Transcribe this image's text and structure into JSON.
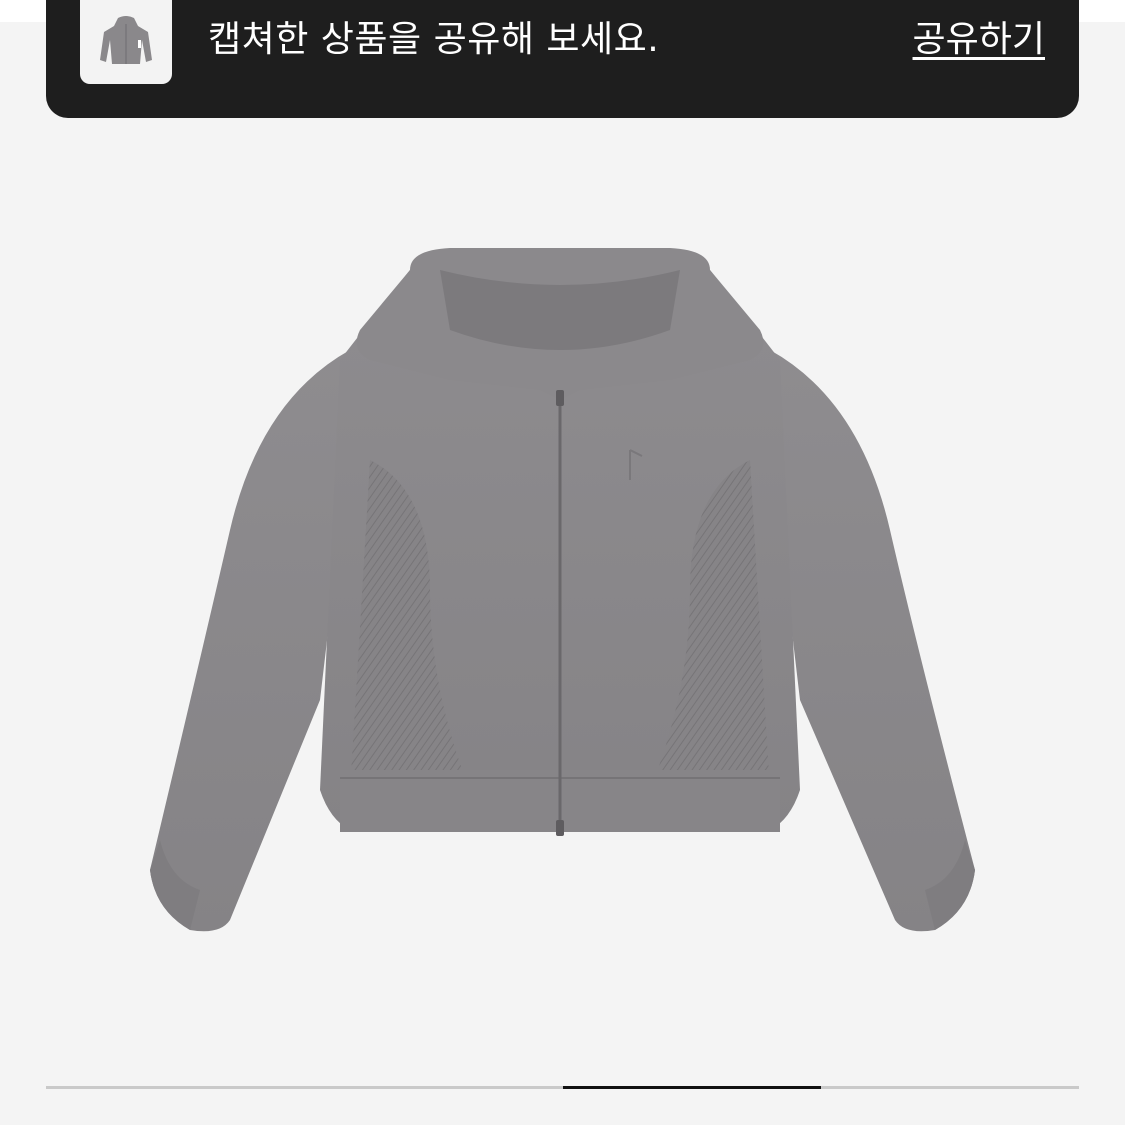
{
  "toast": {
    "message": "캡쳐한 상품을 공유해 보세요.",
    "share_label": "공유하기",
    "thumbnail_icon": "hoodie-thumbnail",
    "background_color": "#1e1e1e"
  },
  "product": {
    "image_icon": "gray-zip-up-hoodie",
    "color": "#8a888b"
  },
  "gallery": {
    "slide_count": 4,
    "current_slide": 3
  }
}
